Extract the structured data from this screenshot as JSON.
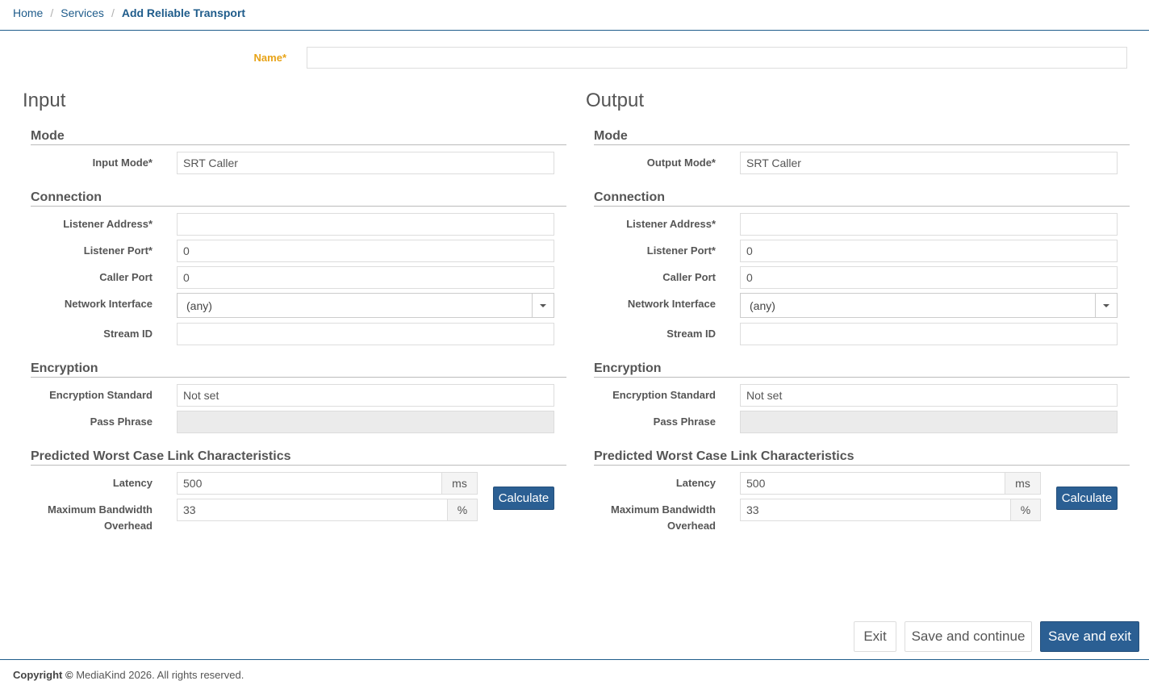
{
  "breadcrumb": {
    "home": "Home",
    "services": "Services",
    "current": "Add Reliable Transport",
    "separator": "/"
  },
  "name_field": {
    "label": "Name*",
    "value": ""
  },
  "input": {
    "title": "Input",
    "mode_section": "Mode",
    "mode_label": "Input Mode*",
    "mode_value": "SRT Caller",
    "connection_section": "Connection",
    "listener_address_label": "Listener Address*",
    "listener_address_value": "",
    "listener_port_label": "Listener Port*",
    "listener_port_value": "0",
    "caller_port_label": "Caller Port",
    "caller_port_value": "0",
    "network_interface_label": "Network Interface",
    "network_interface_value": "(any)",
    "stream_id_label": "Stream ID",
    "stream_id_value": "",
    "encryption_section": "Encryption",
    "encryption_standard_label": "Encryption Standard",
    "encryption_standard_value": "Not set",
    "pass_phrase_label": "Pass Phrase",
    "pass_phrase_value": "",
    "link_section": "Predicted Worst Case Link Characteristics",
    "latency_label": "Latency",
    "latency_value": "500",
    "latency_unit": "ms",
    "bandwidth_label_1": "Maximum Bandwidth",
    "bandwidth_label_2": "Overhead",
    "bandwidth_value": "33",
    "bandwidth_unit": "%",
    "calculate_label": "Calculate"
  },
  "output": {
    "title": "Output",
    "mode_section": "Mode",
    "mode_label": "Output Mode*",
    "mode_value": "SRT Caller",
    "connection_section": "Connection",
    "listener_address_label": "Listener Address*",
    "listener_address_value": "",
    "listener_port_label": "Listener Port*",
    "listener_port_value": "0",
    "caller_port_label": "Caller Port",
    "caller_port_value": "0",
    "network_interface_label": "Network Interface",
    "network_interface_value": "(any)",
    "stream_id_label": "Stream ID",
    "stream_id_value": "",
    "encryption_section": "Encryption",
    "encryption_standard_label": "Encryption Standard",
    "encryption_standard_value": "Not set",
    "pass_phrase_label": "Pass Phrase",
    "pass_phrase_value": "",
    "link_section": "Predicted Worst Case Link Characteristics",
    "latency_label": "Latency",
    "latency_value": "500",
    "latency_unit": "ms",
    "bandwidth_label_1": "Maximum Bandwidth",
    "bandwidth_label_2": "Overhead",
    "bandwidth_value": "33",
    "bandwidth_unit": "%",
    "calculate_label": "Calculate"
  },
  "actions": {
    "exit": "Exit",
    "save_continue": "Save and continue",
    "save_exit": "Save and exit"
  },
  "footer": {
    "copyright_bold": "Copyright ©",
    "copyright_rest": " MediaKind 2026. All rights reserved."
  },
  "colors": {
    "primary": "#2b5f93",
    "link": "#1f5c8b",
    "required_label": "#e8a317"
  }
}
